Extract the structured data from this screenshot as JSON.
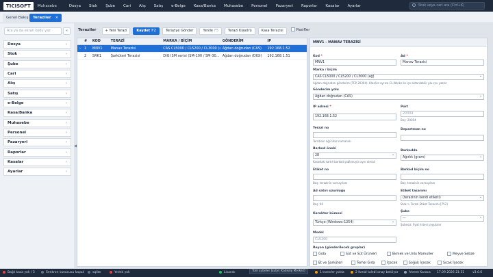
{
  "app": {
    "logo": "TICISOFT",
    "brand": "Muhasebe"
  },
  "menu": [
    "Dosya",
    "Stok",
    "Şube",
    "Cari",
    "Alış",
    "Satış",
    "e-Belge",
    "Kasa/Banka",
    "Muhasebe",
    "Personel",
    "Pazaryeri",
    "Raporlar",
    "Kasalar",
    "Ayarlar"
  ],
  "search": {
    "placeholder": "Stok veya cari ara (Ctrl+K)"
  },
  "tabs": {
    "home": "Genel Bakış",
    "active": "Teraziler",
    "close": "×"
  },
  "sidebar": {
    "search_placeholder": "Ara ya da ekran kodu yaz",
    "button": "«",
    "collapse": "◀",
    "items": [
      "Dosya",
      "Stok",
      "Şube",
      "Cari",
      "Alış",
      "Satış",
      "e-Belge",
      "Kasa/Banka",
      "Muhasebe",
      "Personel",
      "Pazaryeri",
      "Raporlar",
      "Kasalar",
      "Ayarlar"
    ]
  },
  "toolbar": {
    "title": "Teraziler",
    "new": "+ Yeni Terazi",
    "save": "Kaydet",
    "save_sc": "F2",
    "send": "Teraziye Gönder",
    "refresh": "Yenile",
    "refresh_sc": "F5",
    "folder": "Terazi Klasörü",
    "cash": "Kasa Terazisi",
    "passive": "Pasifler"
  },
  "grid": {
    "headers": [
      "#",
      "KOD",
      "TERAZİ",
      "MARKA / BİÇİM",
      "GÖNDERİM",
      "IP"
    ],
    "rows": [
      {
        "no": "1",
        "kod": "MNV1",
        "terazi": "Manav Terazisi",
        "marka": "CAS CL5000 / CL5200 / CL3000 (ağ)",
        "gonderim": "Ağdan doğrudan (CAS)",
        "ip": "192.168.1.52"
      },
      {
        "no": "2",
        "kod": "SRK1",
        "terazi": "Şarküteri Terazisi",
        "marka": "DIGI SM serisi (SM-100 / SM-30...",
        "gonderim": "Ağdan doğrudan (DIGI)",
        "ip": "192.168.1.51"
      }
    ]
  },
  "detail": {
    "header": "MNV1 - MANAV TERAZİSİ",
    "kod_label": "Kod",
    "kod": "MNV1",
    "ad_label": "Ad",
    "ad": "Manav Terazisi",
    "marka_label": "Marka / biçim",
    "marka": "CAS CL5000 / CL5200 / CL3000 (ağ)",
    "marka_hint": "Ağdan doğrudan gönderim (TCP 20304). Klasöre ayrıca CL-Works ile içe aktarılabilir plu.csv yazılır",
    "gonderim_label": "Gönderim yolu",
    "gonderim": "Ağdan doğrudan (CAS)",
    "ip_label": "IP adresi",
    "ip": "192.168.1.52",
    "port_label": "Port",
    "port_ph": "20304",
    "port_hint": "Boş: 20304",
    "terazi_no_label": "Terazi no",
    "terazi_no_hint": "Terazinin ağ/cihaz numarası",
    "departman_label": "Departman no",
    "barkod_onek_label": "Barkod öneki",
    "barkod_onek": "28",
    "barkod_onek_hint": "Kasadaki tartılı barkod şablonuyla aynı olmalı",
    "barkodda_label": "Barkodda",
    "barkodda": "Ağırlık (gram)",
    "etiket_label": "Etiket no",
    "etiket_hint": "Boş: terazinin varsayılanı",
    "barkod_bicim_label": "Barkod biçim no",
    "barkod_bicim_hint": "Boş: terazinin varsayılanı",
    "ad_satir_label": "Ad satırı uzunluğu",
    "ad_satir_hint": "Boş: 40",
    "tasarim_label": "Etiket tasarımı",
    "tasarim": "(terazinin kendi etiketi)",
    "tasarim_hint": "Stok > Terazi Etiket Tasarımı [752]",
    "karakter_label": "Karakter kümesi",
    "karakter": "Türkçe (Windows-1254)",
    "sube_label": "Şube",
    "sube": "—",
    "sube_hint": "Şubesiz: fiyat listesi uygulanır",
    "model_label": "Model",
    "model_ph": "CL5200",
    "reyon_label": "Reyon (gönderilecek gruplar)",
    "reyonlar": [
      "Gıda",
      "Süt ve Süt Ürünleri",
      "Ekmek ve Unlu Mamuller",
      "Meyve Sebze",
      "Et ve Şarküteri",
      "Temel Gıda",
      "İçecek",
      "Soğuk İçecek",
      "Sıcak İçecek"
    ]
  },
  "status": {
    "s1": "Bağlı kasa yok / 3",
    "s2": "Senkron sunucusu kapalı",
    "s3": "sqlite",
    "s4": "Yedek yok",
    "s5": "Lisanslı",
    "s6": "Tüm şubeler (şube: Kadıköy Merkez)",
    "s7": "1 transfer yolda",
    "s8": "2 Ikmal talebi onay bekliyor",
    "s9": "Ahmet Karaca",
    "s10": "17.09.2026 21:31",
    "s11": "v3.0.6"
  },
  "colors": {
    "primary": "#1f6fd6",
    "topbar": "#1f2b3d",
    "ok": "#22c55e",
    "warn": "#ef4444",
    "amber": "#f59e0b"
  }
}
